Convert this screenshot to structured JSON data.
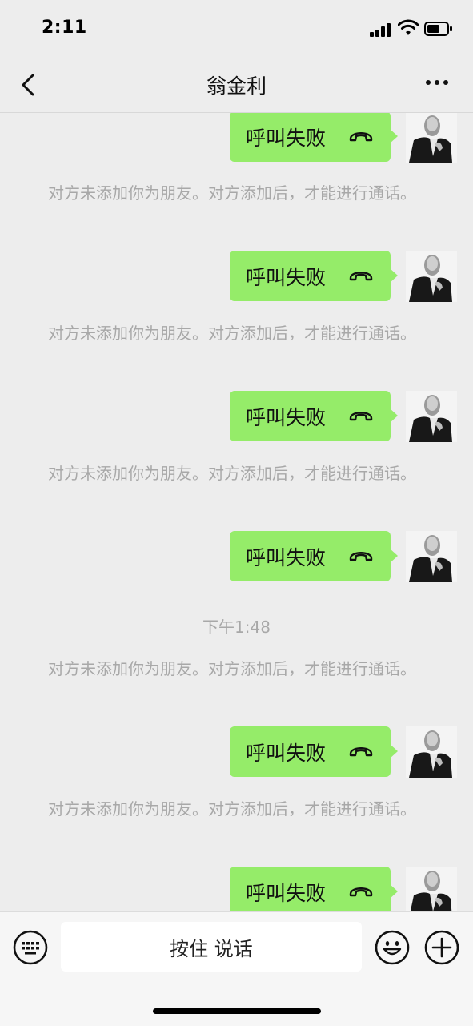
{
  "status_bar": {
    "time": "2:11"
  },
  "nav": {
    "title": "翁金利"
  },
  "messages": [
    {
      "type": "call",
      "text": "呼叫失败"
    },
    {
      "type": "system",
      "text": "对方未添加你为朋友。对方添加后，才能进行通话。"
    },
    {
      "type": "call",
      "text": "呼叫失败"
    },
    {
      "type": "system",
      "text": "对方未添加你为朋友。对方添加后，才能进行通话。"
    },
    {
      "type": "call",
      "text": "呼叫失败"
    },
    {
      "type": "system",
      "text": "对方未添加你为朋友。对方添加后，才能进行通话。"
    },
    {
      "type": "call",
      "text": "呼叫失败"
    },
    {
      "type": "timestamp",
      "text": "下午1:48"
    },
    {
      "type": "system",
      "text": "对方未添加你为朋友。对方添加后，才能进行通话。"
    },
    {
      "type": "call",
      "text": "呼叫失败"
    },
    {
      "type": "system",
      "text": "对方未添加你为朋友。对方添加后，才能进行通话。"
    },
    {
      "type": "call",
      "text": "呼叫失败"
    }
  ],
  "input_bar": {
    "hold_to_talk": "按住 说话"
  },
  "colors": {
    "bubble": "#95ec69",
    "background": "#ededed",
    "system_text": "#a8a8a8"
  },
  "icons": [
    "signal-icon",
    "wifi-icon",
    "battery-icon",
    "back-arrow-icon",
    "more-icon",
    "hang-up-icon",
    "keyboard-icon",
    "emoji-icon",
    "plus-icon"
  ]
}
